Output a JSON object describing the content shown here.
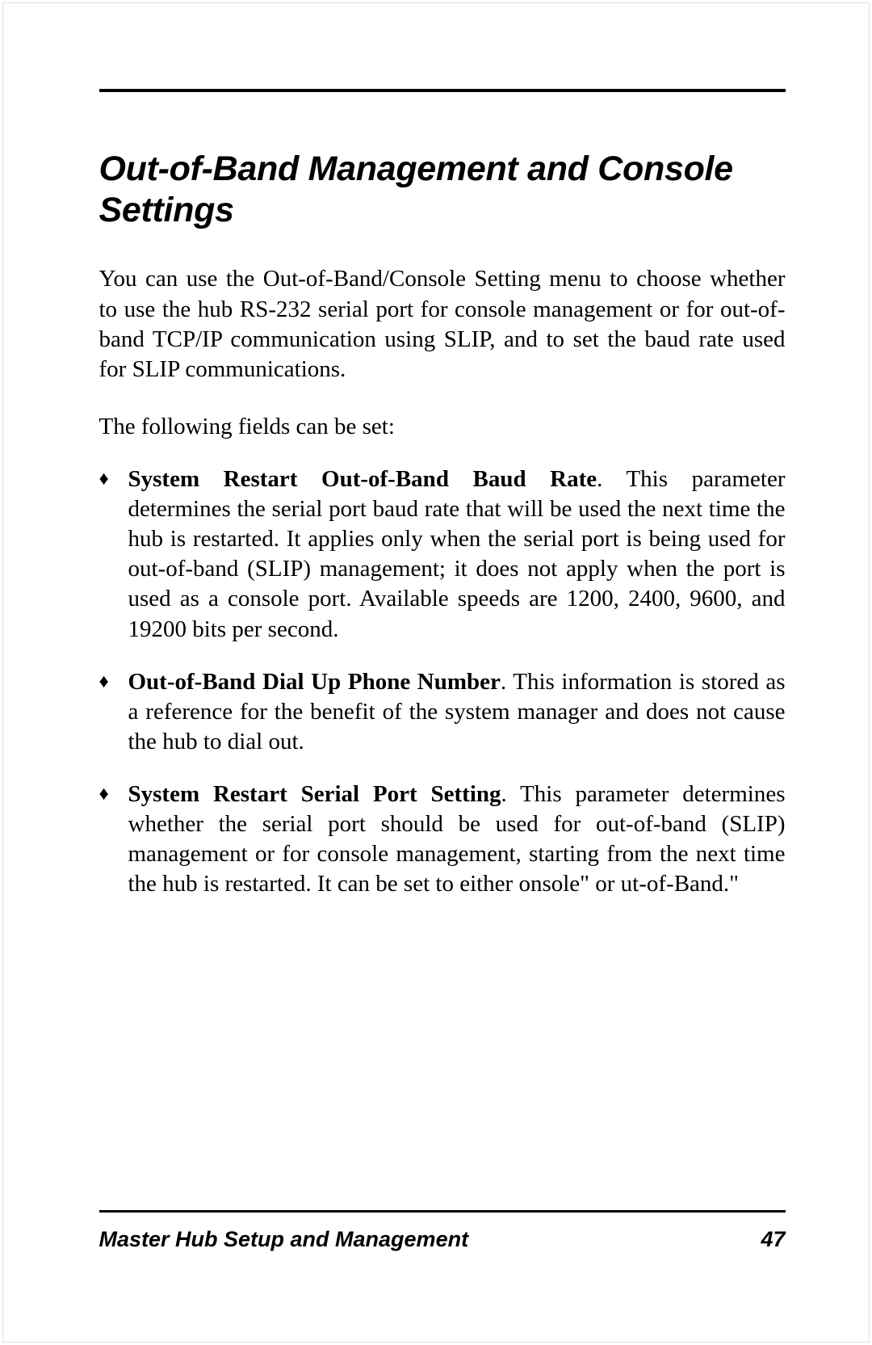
{
  "heading": "Out-of-Band Management and Console Settings",
  "intro": "You can use the Out-of-Band/Console Setting menu to choose whether to use the hub   RS-232 serial port for console management or for out-of-band TCP/IP communication using SLIP, and to set the baud rate used for SLIP communications.",
  "lead": "The following fields can be set:",
  "items": [
    {
      "label": "System Restart Out-of-Band Baud Rate",
      "text": ".  This parameter determines the serial port baud rate that will be used the next time the hub is restarted.  It applies only when the serial port is being used for out-of-band (SLIP) management; it does not apply when the port is used as a console port.  Available speeds are 1200, 2400, 9600, and 19200 bits per second."
    },
    {
      "label": "Out-of-Band Dial Up Phone Number",
      "text": ".  This information is stored as a reference for the benefit of the system manager and does not cause the hub to dial out."
    },
    {
      "label": "System Restart Serial Port Setting",
      "text": ".   This parameter determines whether the serial port should be used for out-of-band (SLIP) management or for console management, starting from the next time the hub is restarted.  It can be set to either    onsole\" or    ut-of-Band.\""
    }
  ],
  "footer": {
    "title": "Master Hub Setup and Management",
    "page": "47"
  }
}
